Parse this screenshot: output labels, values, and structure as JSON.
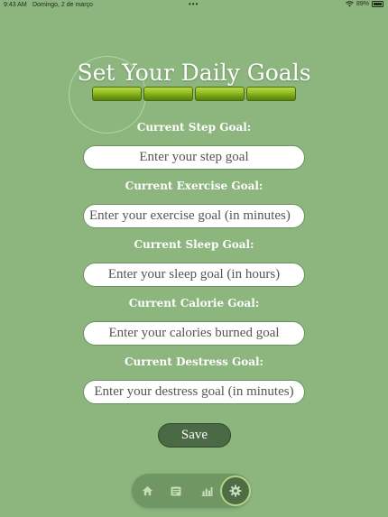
{
  "status_bar": {
    "time": "9:43 AM",
    "date": "Domingo, 2 de março",
    "battery": "89%"
  },
  "page": {
    "title": "Set Your Daily Goals"
  },
  "goals": [
    {
      "label": "Current Step Goal:",
      "placeholder": "Enter your step goal"
    },
    {
      "label": "Current Exercise Goal:",
      "placeholder": "Enter your exercise goal (in minutes)"
    },
    {
      "label": "Current Sleep Goal:",
      "placeholder": "Enter your sleep goal (in hours)"
    },
    {
      "label": "Current Calorie Goal:",
      "placeholder": "Enter your calories burned goal"
    },
    {
      "label": "Current Destress Goal:",
      "placeholder": "Enter your destress goal (in minutes)"
    }
  ],
  "save_label": "Save",
  "tabs": [
    {
      "icon": "home-icon",
      "active": false
    },
    {
      "icon": "journal-icon",
      "active": false
    },
    {
      "icon": "bar-chart-icon",
      "active": false
    },
    {
      "icon": "gear-icon",
      "active": true
    }
  ],
  "colors": {
    "background": "#8db67f",
    "save_button": "#4a6a45",
    "tab_bar": "#6f9663",
    "bamboo": "#9ac626"
  }
}
